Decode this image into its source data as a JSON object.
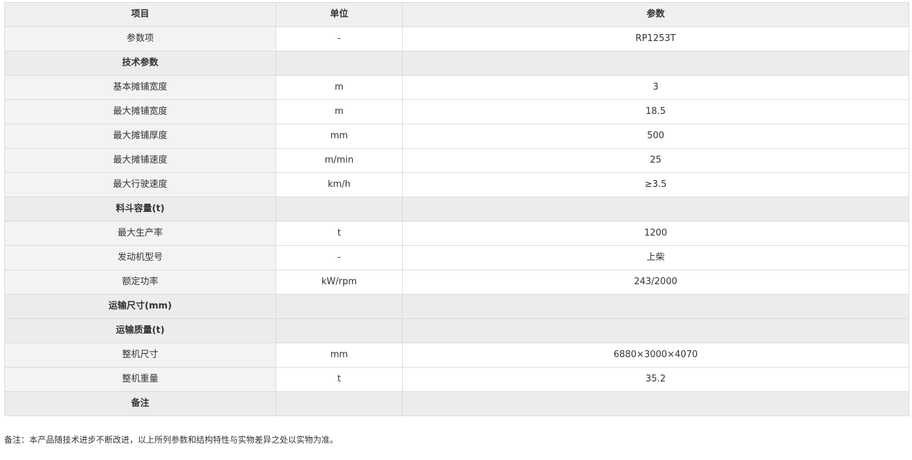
{
  "table": {
    "headers": [
      "项目",
      "单位",
      "参数"
    ],
    "rows": [
      {
        "item": "参数项",
        "unit": "-",
        "value": "RP1253T",
        "section": false
      },
      {
        "item": "技术参数",
        "unit": "",
        "value": "",
        "section": true
      },
      {
        "item": "基本摊铺宽度",
        "unit": "m",
        "value": "3",
        "section": false
      },
      {
        "item": "最大摊铺宽度",
        "unit": "m",
        "value": "18.5",
        "section": false
      },
      {
        "item": "最大摊铺厚度",
        "unit": "mm",
        "value": "500",
        "section": false
      },
      {
        "item": "最大摊铺速度",
        "unit": "m/min",
        "value": "25",
        "section": false
      },
      {
        "item": "最大行驶速度",
        "unit": "km/h",
        "value": "≥3.5",
        "section": false
      },
      {
        "item": "料斗容量(t)",
        "unit": "",
        "value": "",
        "section": true
      },
      {
        "item": "最大生产率",
        "unit": "t",
        "value": "1200",
        "section": false
      },
      {
        "item": "发动机型号",
        "unit": "-",
        "value": "上柴",
        "section": false
      },
      {
        "item": "额定功率",
        "unit": "kW/rpm",
        "value": "243/2000",
        "section": false
      },
      {
        "item": "运输尺寸(mm)",
        "unit": "",
        "value": "",
        "section": true
      },
      {
        "item": "运输质量(t)",
        "unit": "",
        "value": "",
        "section": true
      },
      {
        "item": "整机尺寸",
        "unit": "mm",
        "value": "6880×3000×4070",
        "section": false
      },
      {
        "item": "整机重量",
        "unit": "t",
        "value": "35.2",
        "section": false
      },
      {
        "item": "备注",
        "unit": "",
        "value": "",
        "section": true
      }
    ]
  },
  "footnote": "备注：本产品随技术进步不断改进，以上所列参数和结构特性与实物差异之处以实物为准。"
}
